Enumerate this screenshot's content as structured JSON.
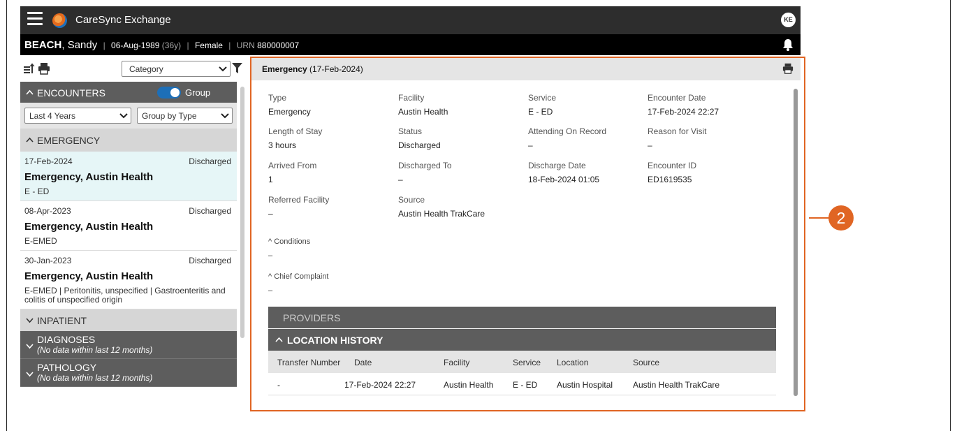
{
  "app": {
    "title": "CareSync Exchange",
    "user_initials": "KE"
  },
  "patient": {
    "last_name": "BEACH",
    "first_name": "Sandy",
    "dob": "06-Aug-1989",
    "age": "(36y)",
    "gender": "Female",
    "urn_label": "URN",
    "urn": "880000007",
    "sep": "|"
  },
  "left": {
    "category_placeholder": "Category",
    "encounters_label": "ENCOUNTERS",
    "group_label": "Group",
    "range_filter": "Last 4 Years",
    "group_filter": "Group by Type",
    "emergency_label": "EMERGENCY",
    "encounters": [
      {
        "date": "17-Feb-2024",
        "status": "Discharged",
        "title": "Emergency, Austin Health",
        "sub": "E - ED"
      },
      {
        "date": "08-Apr-2023",
        "status": "Discharged",
        "title": "Emergency, Austin Health",
        "sub": "E-EMED"
      },
      {
        "date": "30-Jan-2023",
        "status": "Discharged",
        "title": "Emergency, Austin Health",
        "sub": "E-EMED | Peritonitis, unspecified | Gastroenteritis and colitis of unspecified origin"
      }
    ],
    "inpatient_label": "INPATIENT",
    "diagnoses": {
      "label": "DIAGNOSES",
      "note": "(No data within last 12 months)"
    },
    "pathology": {
      "label": "PATHOLOGY",
      "note": "(No data within last 12 months)"
    }
  },
  "detail": {
    "header_bold": "Emergency",
    "header_date": "(17-Feb-2024)",
    "fields": [
      {
        "key": "Type",
        "value": "Emergency"
      },
      {
        "key": "Facility",
        "value": "Austin Health"
      },
      {
        "key": "Service",
        "value": "E - ED"
      },
      {
        "key": "Encounter Date",
        "value": "17-Feb-2024 22:27"
      },
      {
        "key": "Length of Stay",
        "value": "3 hours"
      },
      {
        "key": "Status",
        "value": "Discharged"
      },
      {
        "key": "Attending On Record",
        "value": "–"
      },
      {
        "key": "Reason for Visit",
        "value": "–"
      },
      {
        "key": "Arrived From",
        "value": "1"
      },
      {
        "key": "Discharged To",
        "value": "–"
      },
      {
        "key": "Discharge Date",
        "value": "18-Feb-2024 01:05"
      },
      {
        "key": "Encounter ID",
        "value": "ED1619535"
      },
      {
        "key": "Referred Facility",
        "value": "–"
      },
      {
        "key": "Source",
        "value": "Austin Health TrakCare"
      }
    ],
    "conditions_label": "Conditions",
    "conditions_value": "–",
    "chief_label": "Chief Complaint",
    "chief_value": "–",
    "providers_label": "PROVIDERS",
    "location_label": "LOCATION HISTORY",
    "location_columns": [
      "Transfer Number",
      "Date",
      "Facility",
      "Service",
      "Location",
      "Source"
    ],
    "location_rows": [
      [
        "-",
        "17-Feb-2024 22:27",
        "Austin Health",
        "E - ED",
        "Austin Hospital",
        "Austin Health TrakCare"
      ]
    ]
  },
  "callout": {
    "number": "2",
    "color": "#e06523"
  },
  "colors": {
    "accent": "#1d6fb8",
    "active_row": "#e6f6f7",
    "section_dark": "#5d5d5d"
  }
}
